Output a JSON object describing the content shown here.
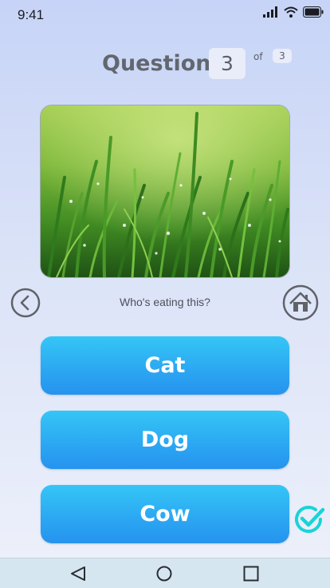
{
  "status_bar": {
    "time": "9:41",
    "icons": [
      "signal-icon",
      "wifi-icon",
      "battery-icon"
    ]
  },
  "question": {
    "label": "Question",
    "number": "3",
    "of_label": "of",
    "total": "3"
  },
  "image": {
    "icon": "grass-photo"
  },
  "navigation": {
    "back_icon": "chevron-left-icon",
    "home_icon": "home-icon"
  },
  "prompt": "Who's eating this?",
  "answers": [
    {
      "label": "Cat"
    },
    {
      "label": "Dog"
    },
    {
      "label": "Cow",
      "correct": true
    }
  ],
  "system_nav": {
    "icons": [
      "back-triangle-icon",
      "home-circle-icon",
      "recents-square-icon"
    ]
  },
  "colors": {
    "answer_button": "#2ba6f2",
    "check": "#19d3d8",
    "text_muted": "#62676f",
    "background_top": "#c7d4f7",
    "background_bottom": "#eef1fb"
  }
}
